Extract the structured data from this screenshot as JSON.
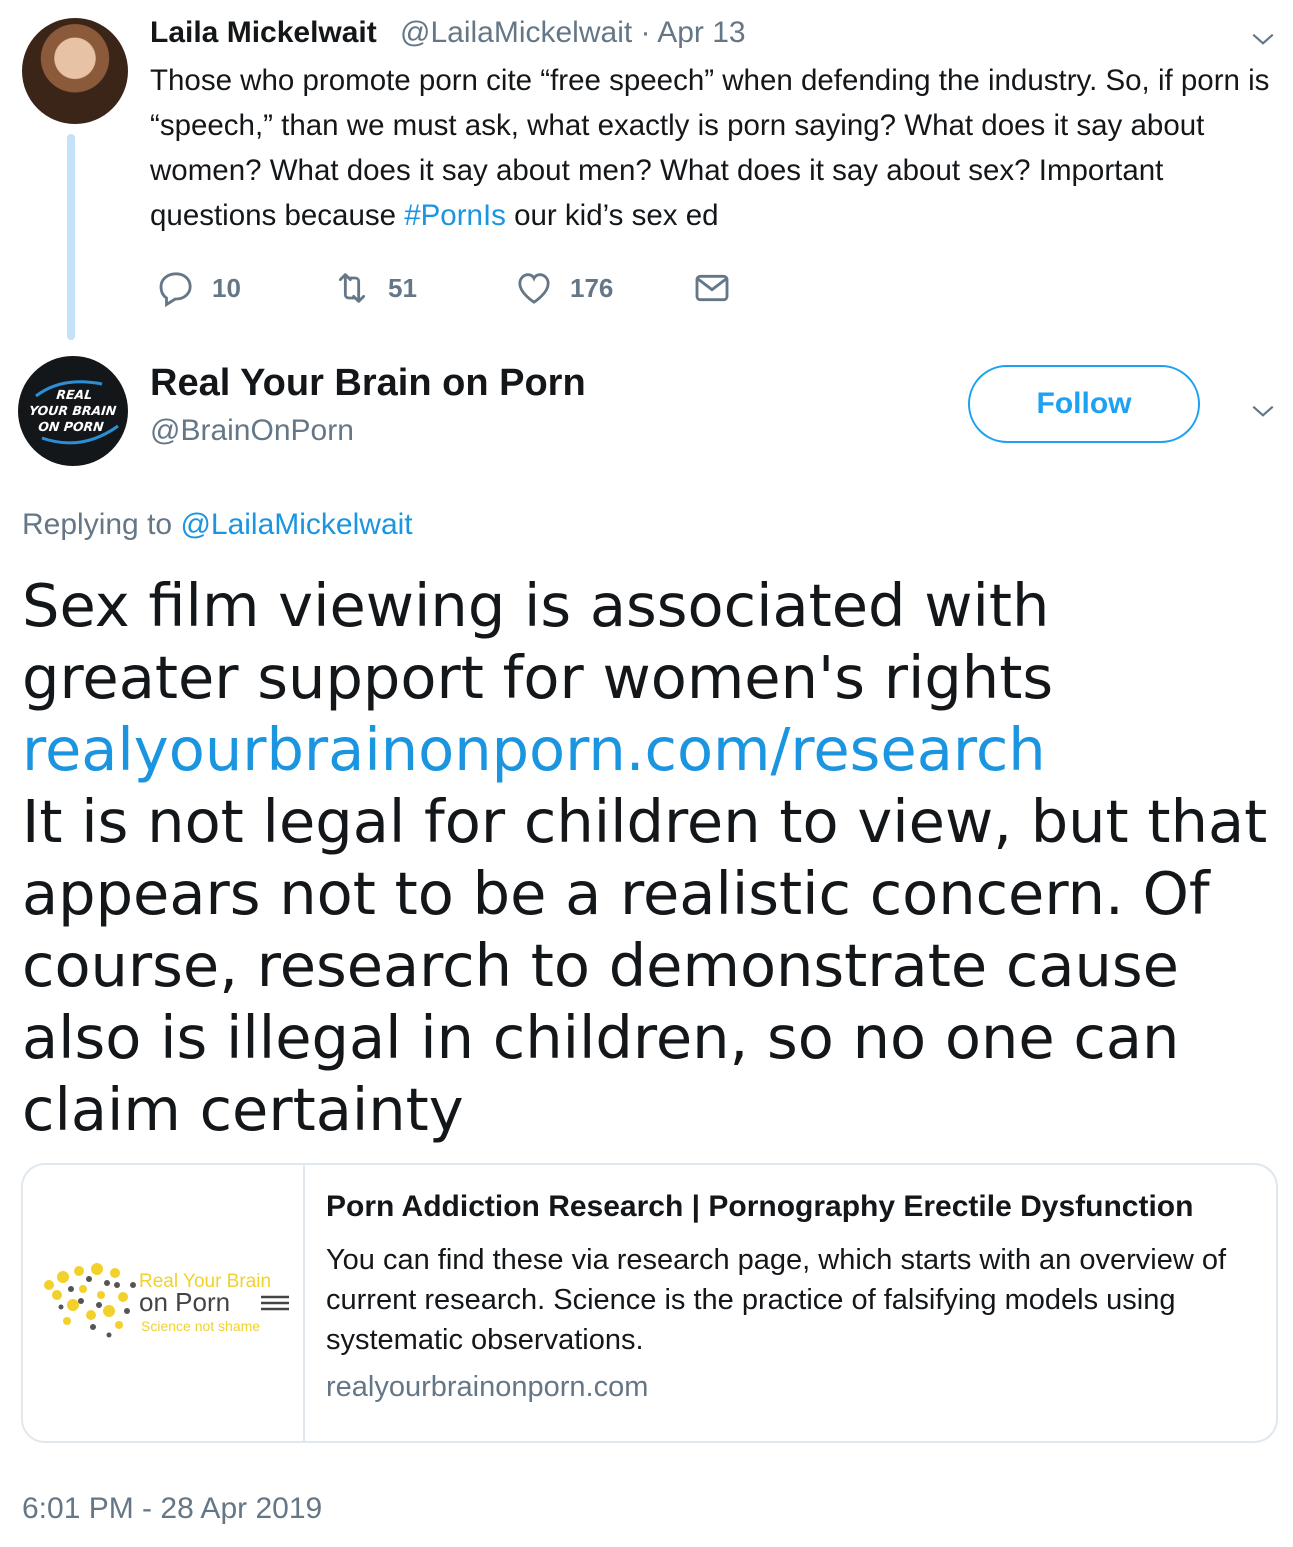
{
  "parent_tweet": {
    "name": "Laila Mickelwait",
    "meta": "@LailaMickelwait · Apr 13",
    "text_before_hashtag": "Those who promote porn cite “free speech” when defending the industry. So, if porn is “speech,” than we must ask, what exactly is porn saying? What does it say about women? What does it say about men? What does it say about sex? Important questions because ",
    "hashtag": "#PornIs",
    "text_after_hashtag": " our kid’s sex ed",
    "replies": "10",
    "retweets": "51",
    "likes": "176"
  },
  "reply_tweet": {
    "avatar_text": [
      "REAL",
      "YOUR BRAIN",
      "ON PORN"
    ],
    "name": "Real Your Brain on Porn",
    "handle": "@BrainOnPorn",
    "follow_label": "Follow",
    "replying_prefix": "Replying to ",
    "replying_mention": "@LailaMickelwait",
    "text_part1": "Sex film viewing is associated with greater support for women's rights",
    "link": "realyourbrainonporn.com/research",
    "text_part2": "It is not legal for children to view, but that appears not to be a realistic concern. Of course, research to demonstrate cause also is illegal in children, so no one can claim certainty",
    "timestamp": "6:01 PM - 28 Apr 2019"
  },
  "card": {
    "logo_line1": "Real Your Brain",
    "logo_line2": "on Porn",
    "logo_line3": "Science not shame",
    "title": "Porn Addiction Research | Pornography Erectile Dysfunction",
    "description": "You can find these via research page, which starts with an overview of current research. Science is the practice of falsifying models using systematic observations.",
    "domain": "realyourbrainonporn.com"
  },
  "colors": {
    "link_blue": "#1b95e0",
    "secondary_gray": "#657786",
    "thread_line": "#c4e2f7",
    "logo_yellow": "#f2d12b"
  }
}
